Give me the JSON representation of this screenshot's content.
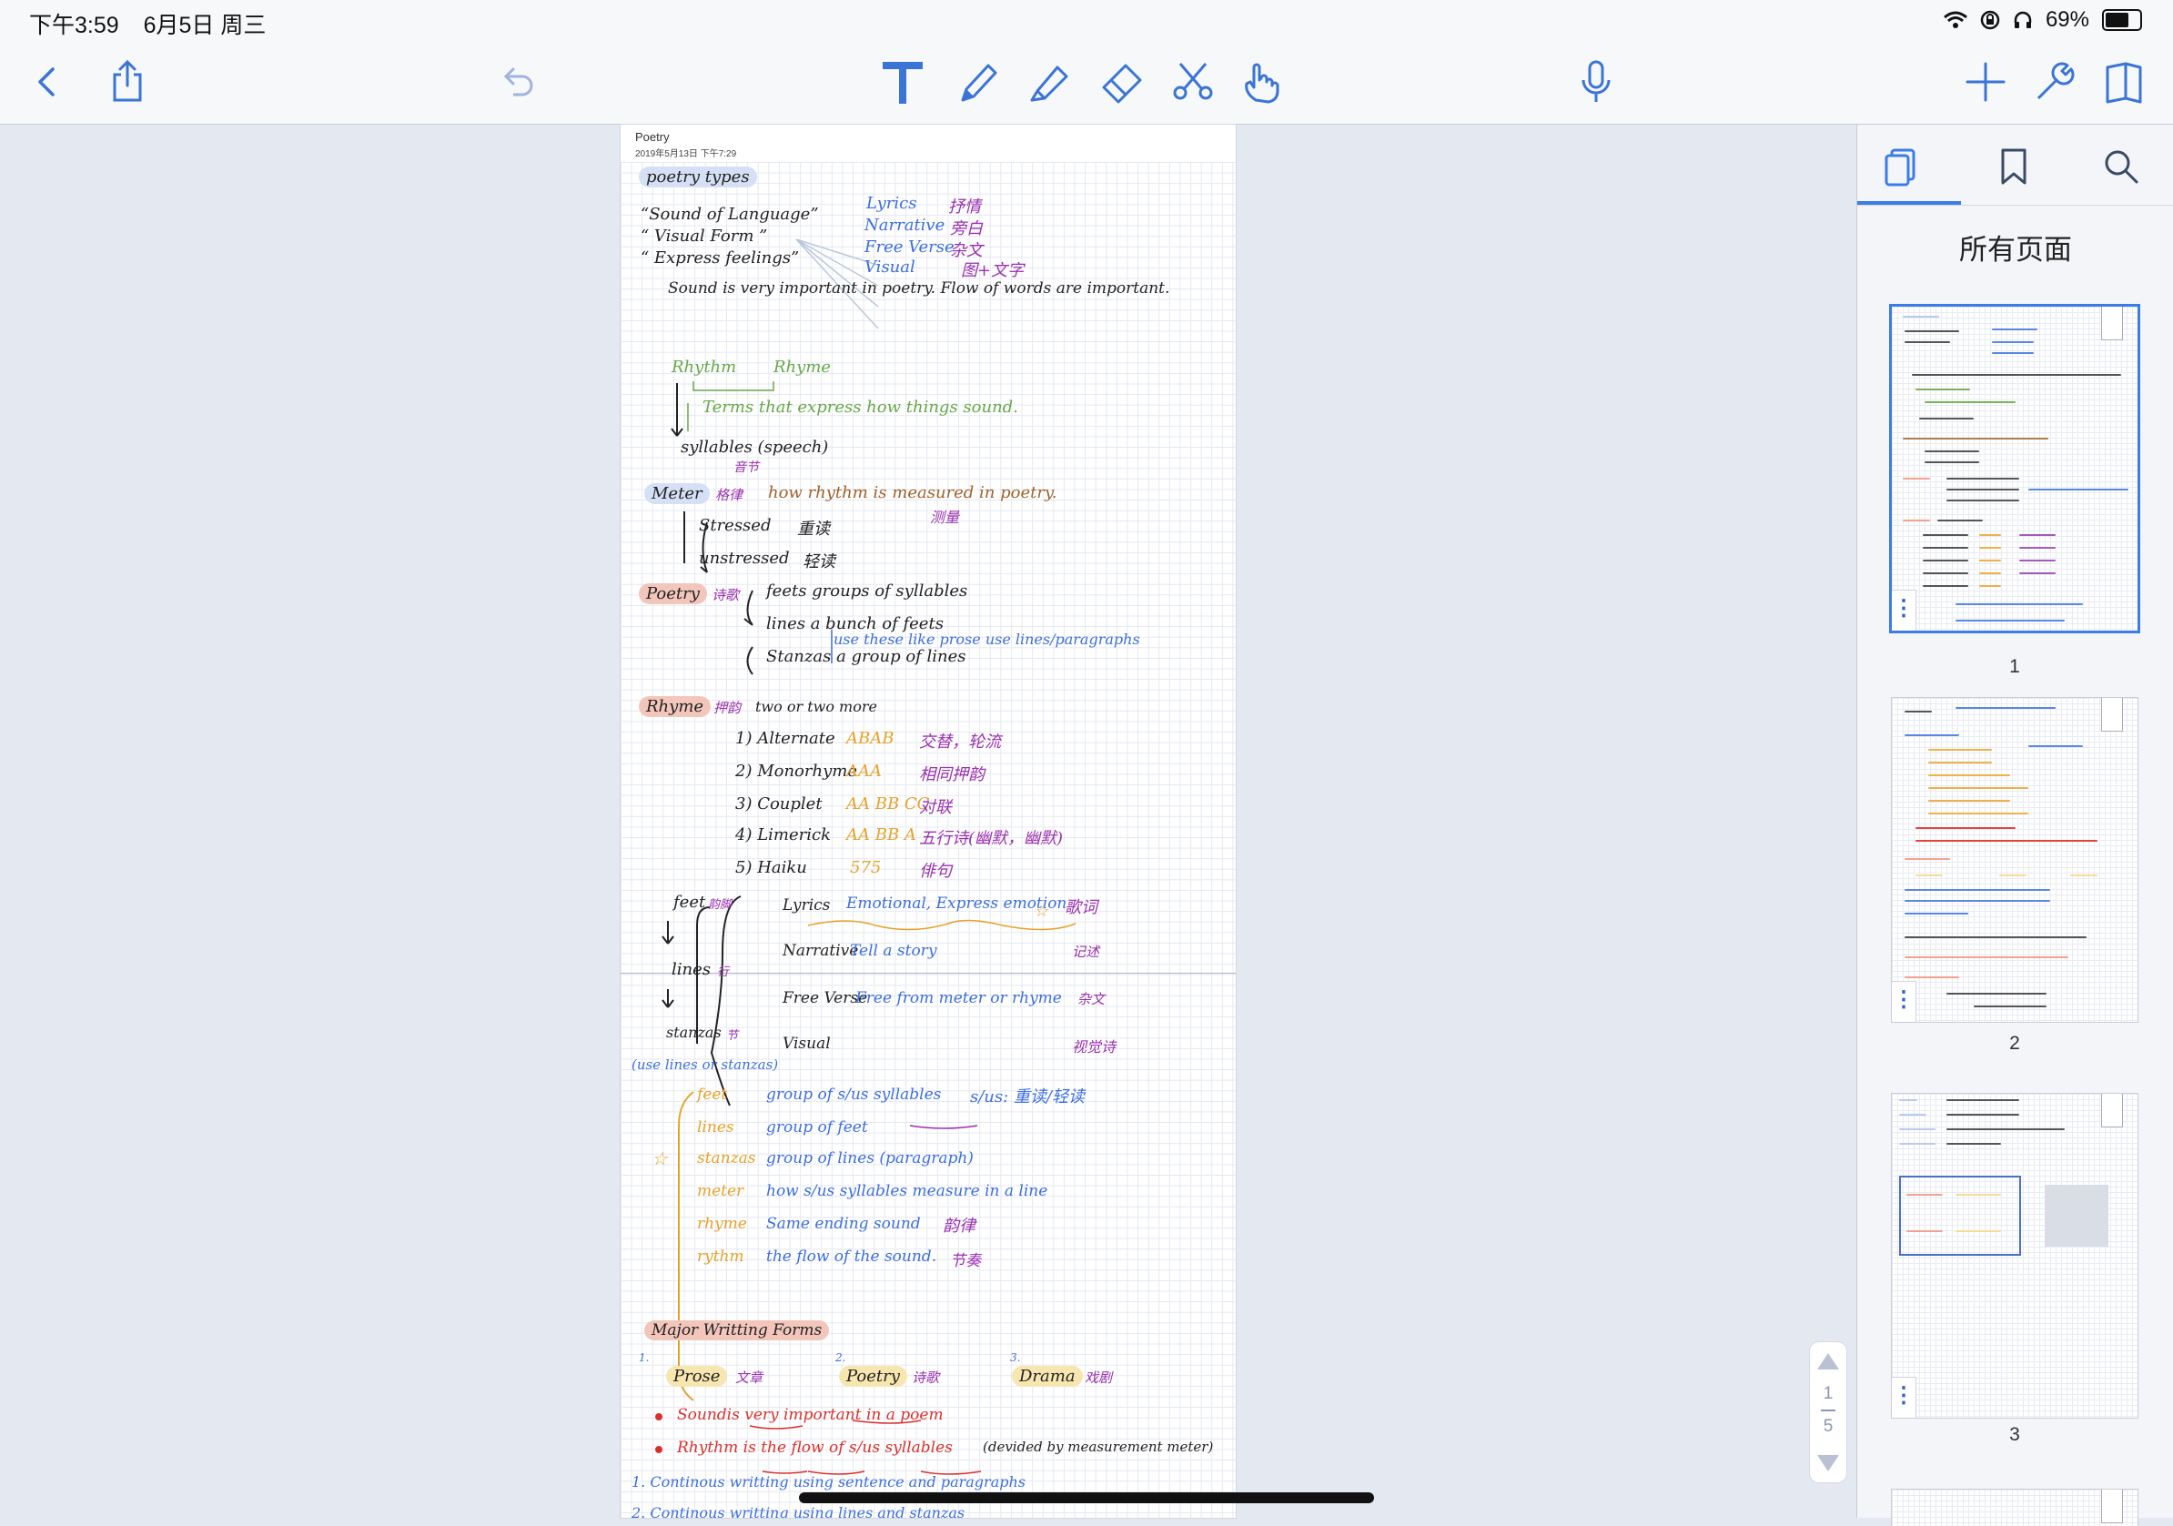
{
  "status": {
    "time": "下午3:59",
    "date": "6月5日 周三",
    "battery": "69%",
    "battery_level": 0.69
  },
  "toolbar": {
    "left": [
      {
        "name": "back-icon"
      },
      {
        "name": "share-icon"
      },
      {
        "name": "undo-icon"
      }
    ],
    "tools": [
      {
        "name": "text-tool-icon"
      },
      {
        "name": "pen-tool-icon"
      },
      {
        "name": "highlighter-tool-icon"
      },
      {
        "name": "eraser-tool-icon"
      },
      {
        "name": "lasso-scissors-icon"
      },
      {
        "name": "hand-pointer-icon"
      }
    ],
    "right": [
      {
        "name": "microphone-icon"
      },
      {
        "name": "add-icon"
      },
      {
        "name": "wrench-icon"
      },
      {
        "name": "pages-view-icon"
      }
    ]
  },
  "document": {
    "title": "Poetry",
    "date": "2019年5月13日 下午7:29"
  },
  "notes": {
    "n1": "poetry types",
    "n2": "“Sound of Language”",
    "n3": "“ Visual Form ”",
    "n4": "“ Express feelings”",
    "n5": "Lyrics",
    "n6": "抒情",
    "n7": "Narrative",
    "n8": "旁白",
    "n9": "Free Verse",
    "n10": "杂文",
    "n11": "Visual",
    "n12": "图+文字",
    "n13": "Sound is very important in poetry. Flow of words are important.",
    "n14": "Rhythm",
    "n15": "Rhyme",
    "n16": "Terms that express how things sound.",
    "n17": "syllables (speech)",
    "n18": "音节",
    "n19": "Meter",
    "n20": "格律",
    "n21": "how rhythm is measured in poetry.",
    "n22": "测量",
    "n23": "Stressed",
    "n24": "重读",
    "n25": "unstressed",
    "n26": "轻读",
    "n27": "Poetry",
    "n28": "诗歌",
    "n29": "feets groups of syllables",
    "n30": "lines a bunch of feets",
    "n31": "Stanzas a group of lines",
    "n32": "use these like prose use lines/paragraphs",
    "n33": "Rhyme",
    "n34": "押韵",
    "n35": "two or two more",
    "n36": "1) Alternate",
    "n37": "ABAB",
    "n38": "交替，轮流",
    "n39": "2) Monorhyme",
    "n40": "AAA",
    "n41": "相同押韵",
    "n42": "3) Couplet",
    "n43": "AA BB CC",
    "n44": "对联",
    "n45": "4) Limerick",
    "n46": "AA BB A",
    "n47": "五行诗(幽默，幽默)",
    "n48": "5) Haiku",
    "n49": "575",
    "n50": "俳句",
    "n51": "feet",
    "n52": "韵脚",
    "n53": "lines",
    "n54": "行",
    "n55": "stanzas",
    "n56": "节",
    "n57": "Lyrics",
    "n58": "Emotional, Express emotion",
    "n59": "歌词",
    "n60": "Narrative",
    "n61": "Tell a story",
    "n62": "记述",
    "n63": "Free Verse",
    "n64": "Free from meter or rhyme",
    "n65": "杂文",
    "n66": "Visual",
    "n67": "视觉诗",
    "n68": "(use lines or stanzas)",
    "n69": "feet",
    "n70": "group of s/us syllables",
    "n71": "s/us: 重读/轻读",
    "n72": "lines",
    "n73": "group of feet",
    "n74": "stanzas",
    "n75": "group of lines (paragraph)",
    "n76": "meter",
    "n77": "how s/us syllables measure in a line",
    "n78": "rhyme",
    "n79": "Same ending sound",
    "n80": "韵律",
    "n81": "rythm",
    "n82": "the flow of the sound.",
    "n83": "节奏",
    "n84": "Soundis very important in a poem",
    "n85": "Rhythm is the flow of s/us syllables",
    "n86": "(devided by measurement meter)",
    "n87": "Major Writting Forms",
    "n88": "Prose",
    "n89": "文章",
    "n90": "Poetry",
    "n91": "诗歌",
    "n92": "Drama",
    "n93": "戏剧",
    "n94": "1. Continous writting using sentence and paragraphs",
    "n95": "2. Continous writting using lines and stanzas",
    "n96": "1.",
    "n97": "2.",
    "n98": "3.",
    "n99": "☆",
    "n100": "☆"
  },
  "scroll": {
    "current": "1",
    "total": "5"
  },
  "sidebar": {
    "tabs": [
      {
        "name": "tab-all-pages"
      },
      {
        "name": "tab-bookmarks"
      },
      {
        "name": "tab-search"
      }
    ],
    "title": "所有页面",
    "pages": [
      "1",
      "2",
      "3"
    ]
  },
  "colors": {
    "accent": "#3a7ce8",
    "highlight_blue": "#d5e0f6",
    "highlight_red": "#f3c6bb",
    "highlight_yellow": "#f7e6b0",
    "ink_blue": "#3c6ee0",
    "ink_purple": "#9a2fb0",
    "ink_orange": "#e7a12a",
    "ink_green": "#67a84a",
    "ink_red": "#d9302c"
  }
}
